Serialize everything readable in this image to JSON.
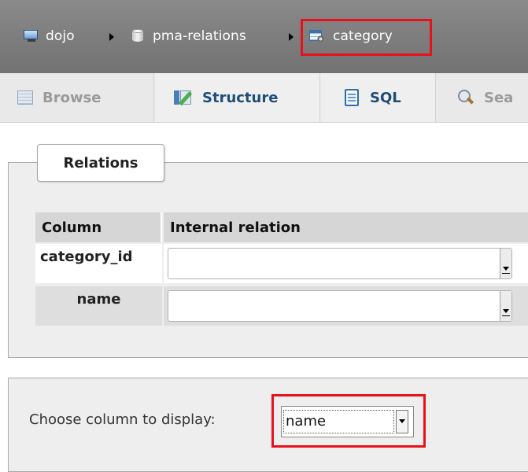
{
  "breadcrumb": {
    "server": "dojo",
    "database": "pma-relations",
    "table": "category",
    "server_icon": "server-icon",
    "database_icon": "database-icon",
    "table_icon": "table-icon"
  },
  "tabs": [
    {
      "label": "Browse",
      "icon": "browse-icon"
    },
    {
      "label": "Structure",
      "icon": "structure-icon"
    },
    {
      "label": "SQL",
      "icon": "sql-icon"
    },
    {
      "label": "Sea",
      "icon": "search-icon"
    }
  ],
  "relations": {
    "legend": "Relations",
    "headers": {
      "column": "Column",
      "internal_relation": "Internal relation"
    },
    "rows": [
      {
        "column": "category_id",
        "internal_relation": ""
      },
      {
        "column": "name",
        "internal_relation": ""
      }
    ]
  },
  "display": {
    "label": "Choose column to display:",
    "selected": "name"
  },
  "colors": {
    "highlight": "#e8111b",
    "breadcrumb_bg": "#7f7f7f",
    "tab_text_active": "#1f4d7a"
  }
}
